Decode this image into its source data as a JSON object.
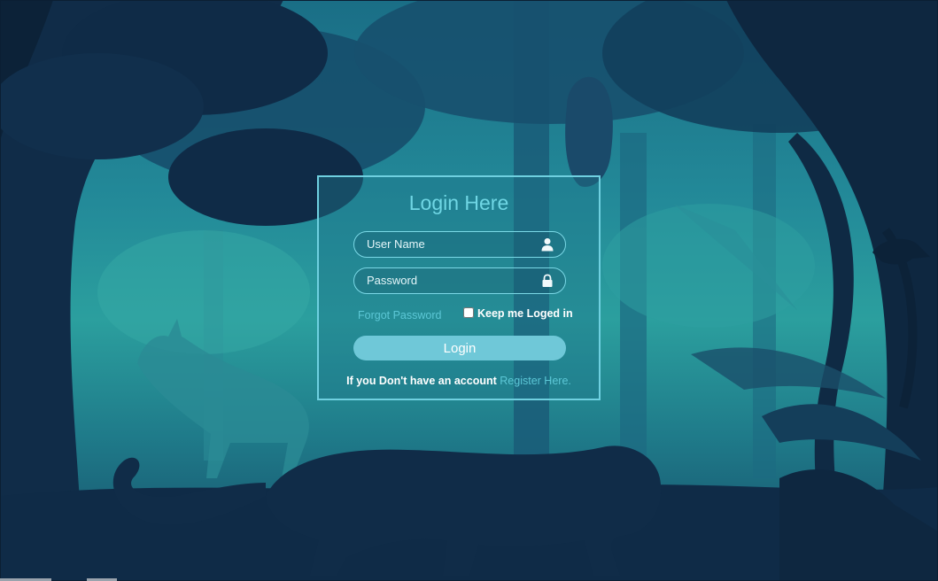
{
  "login": {
    "title": "Login Here",
    "username_placeholder": "User Name",
    "password_placeholder": "Password",
    "forgot_password": "Forgot Password",
    "keep_logged_in": "Keep me Loged in",
    "login_button": "Login",
    "register_prefix": "If you Don't have an account",
    "register_link": "Register Here."
  },
  "icons": {
    "username": "user-icon",
    "password": "lock-icon"
  },
  "colors": {
    "accent": "#6fd0e0",
    "button": "#6fc8d8",
    "link": "#5cc7d6"
  }
}
